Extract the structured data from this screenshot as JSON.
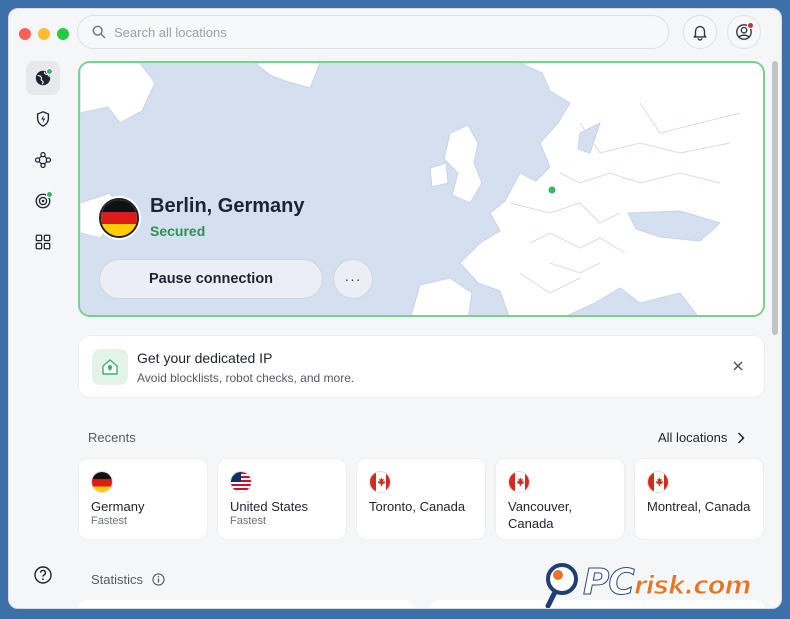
{
  "search": {
    "placeholder": "Search all locations"
  },
  "connection": {
    "city": "Berlin, Germany",
    "status": "Secured",
    "pause_label": "Pause connection",
    "more_label": "···",
    "colors": {
      "status": "#2f8f53",
      "map_border": "#7ccf8e"
    }
  },
  "promo": {
    "title": "Get your dedicated IP",
    "subtitle": "Avoid blocklists, robot checks, and more."
  },
  "recents": {
    "heading": "Recents",
    "all_label": "All locations",
    "items": [
      {
        "name": "Germany",
        "sub": "Fastest",
        "flag": "de"
      },
      {
        "name": "United States",
        "sub": "Fastest",
        "flag": "us"
      },
      {
        "name": "Toronto, Canada",
        "sub": "",
        "flag": "ca"
      },
      {
        "name": "Vancouver, Canada",
        "sub": "",
        "flag": "ca"
      },
      {
        "name": "Montreal, Canada",
        "sub": "",
        "flag": "ca"
      }
    ]
  },
  "statistics": {
    "heading": "Statistics"
  },
  "sidebar": {
    "items": [
      {
        "icon": "globe-icon",
        "badge": true,
        "active": true
      },
      {
        "icon": "shield-bolt-icon",
        "badge": false
      },
      {
        "icon": "nodes-icon",
        "badge": false
      },
      {
        "icon": "target-icon",
        "badge": true
      },
      {
        "icon": "grid-icon",
        "badge": false
      }
    ],
    "help_icon": "help-icon"
  },
  "watermark": {
    "text": "PC",
    "text2": "risk.com"
  }
}
